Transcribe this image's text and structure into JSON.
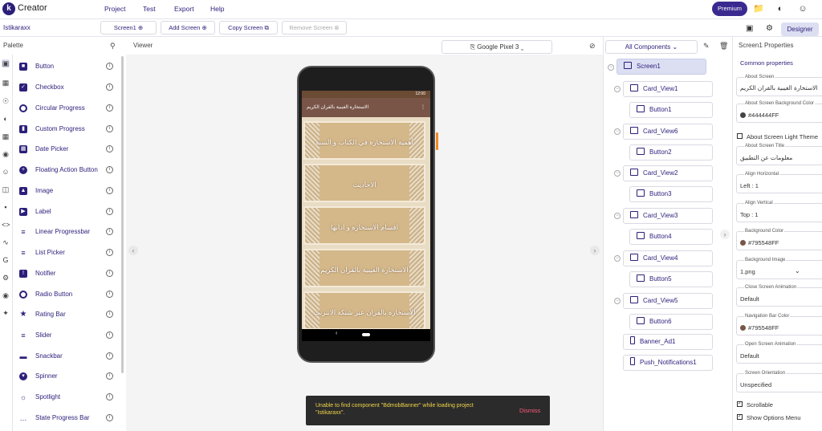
{
  "app": {
    "logo_letter": "k",
    "name": "Creator"
  },
  "menu": [
    "Project",
    "Test",
    "Export",
    "Help"
  ],
  "premium_label": "Premium",
  "project": {
    "name": "Istikaraxx",
    "screen_selector": "Screen1",
    "add_screen": "Add Screen",
    "copy_screen": "Copy Screen",
    "remove_screen": "Remove Screen",
    "designer_label": "Designer"
  },
  "palette": {
    "title": "Palette",
    "items": [
      "Button",
      "Checkbox",
      "Circular Progress",
      "Custom Progress",
      "Date Picker",
      "Floating Action Button",
      "Image",
      "Label",
      "Linear Progressbar",
      "List Picker",
      "Notifier",
      "Radio Button",
      "Rating Bar",
      "Slider",
      "Snackbar",
      "Spinner",
      "Spotlight",
      "State Progress Bar"
    ]
  },
  "viewer": {
    "title": "Viewer",
    "device": "Google Pixel 3",
    "status_time": "12:00",
    "appbar_title": "الاستخارة الغيبية بالقران الكريم",
    "cards": [
      "أهمية الاستخارة في الكتاب و السنة",
      "الاحاديث",
      "اقسام الاستخارة و ادابها",
      "الاستخارة الغيبية بالقران الكريم",
      "الاستخارة بالقران عبر شبكة الانترنت"
    ]
  },
  "components": {
    "selector": "All Components",
    "tree": [
      {
        "label": "Screen1"
      },
      {
        "label": "Card_View1"
      },
      {
        "label": "Button1"
      },
      {
        "label": "Card_View6"
      },
      {
        "label": "Button2"
      },
      {
        "label": "Card_View2"
      },
      {
        "label": "Button3"
      },
      {
        "label": "Card_View3"
      },
      {
        "label": "Button4"
      },
      {
        "label": "Card_View4"
      },
      {
        "label": "Button5"
      },
      {
        "label": "Card_View5"
      },
      {
        "label": "Button6"
      },
      {
        "label": "Banner_Ad1"
      },
      {
        "label": "Push_Notifications1"
      }
    ]
  },
  "properties": {
    "title": "Screen1 Properties",
    "tab": "Common properties",
    "about_screen": {
      "label": "About Screen",
      "value": "الاستخارة الغيبية بالقران الكريم"
    },
    "about_bg_color": {
      "label": "About Screen Background Color",
      "value": "#444444FF",
      "color": "#444444"
    },
    "about_light_theme": "About Screen Light Theme",
    "about_title": {
      "label": "About Screen Title",
      "value": "معلومات عن التطبيق"
    },
    "align_h": {
      "label": "Align Horizontal",
      "value": "Left : 1"
    },
    "align_v": {
      "label": "Align Vertical",
      "value": "Top : 1"
    },
    "bg_color": {
      "label": "Background Color",
      "value": "#795548FF",
      "color": "#795548"
    },
    "bg_image": {
      "label": "Background Image",
      "value": "1.png"
    },
    "close_anim": {
      "label": "Close Screen Animation",
      "value": "Default"
    },
    "nav_color": {
      "label": "Navigation Bar Color",
      "value": "#795548FF",
      "color": "#795548"
    },
    "open_anim": {
      "label": "Open Screen Animation",
      "value": "Default"
    },
    "orientation": {
      "label": "Screen Orientation",
      "value": "Unspecified"
    },
    "scrollable": "Scrollable",
    "show_options": "Show Options Menu"
  },
  "toast": {
    "message": "Unable to find component \"BdmobBanner\" while loading project \"Istikaraxx\".",
    "dismiss": "Dismiss"
  }
}
